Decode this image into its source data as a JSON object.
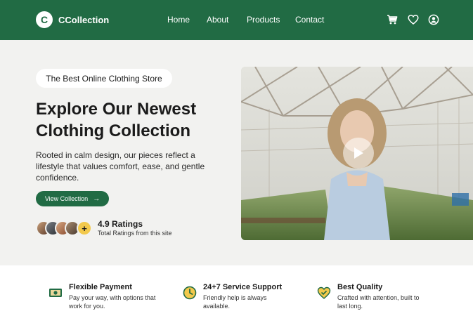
{
  "header": {
    "logo_letter": "C",
    "brand": "CCollection",
    "nav": [
      "Home",
      "About",
      "Products",
      "Contact"
    ],
    "icons": [
      "cart-icon",
      "heart-icon",
      "user-icon"
    ]
  },
  "hero": {
    "badge": "The Best Online Clothing Store",
    "headline_line1": "Explore Our Newest",
    "headline_line2": "Clothing Collection",
    "description": "Rooted in calm design, our pieces reflect a lifestyle that values comfort, ease, and gentle confidence.",
    "cta_label": "View Collection",
    "rating_value": "4.9 Ratings",
    "rating_sub": "Total Ratings from this site",
    "avatar_plus": "+"
  },
  "features": [
    {
      "title": "Flexible Payment",
      "desc": "Pay your way, with options that work for you.",
      "icon": "payment-icon"
    },
    {
      "title": "24+7 Service Support",
      "desc": "Friendly help is always available.",
      "icon": "clock-icon"
    },
    {
      "title": "Best Quality",
      "desc": "Crafted with attention, built to last long.",
      "icon": "quality-heart-icon"
    }
  ],
  "colors": {
    "brand_green": "#216b44",
    "background": "#f2f2f0",
    "accent_yellow": "#f2c94c"
  }
}
